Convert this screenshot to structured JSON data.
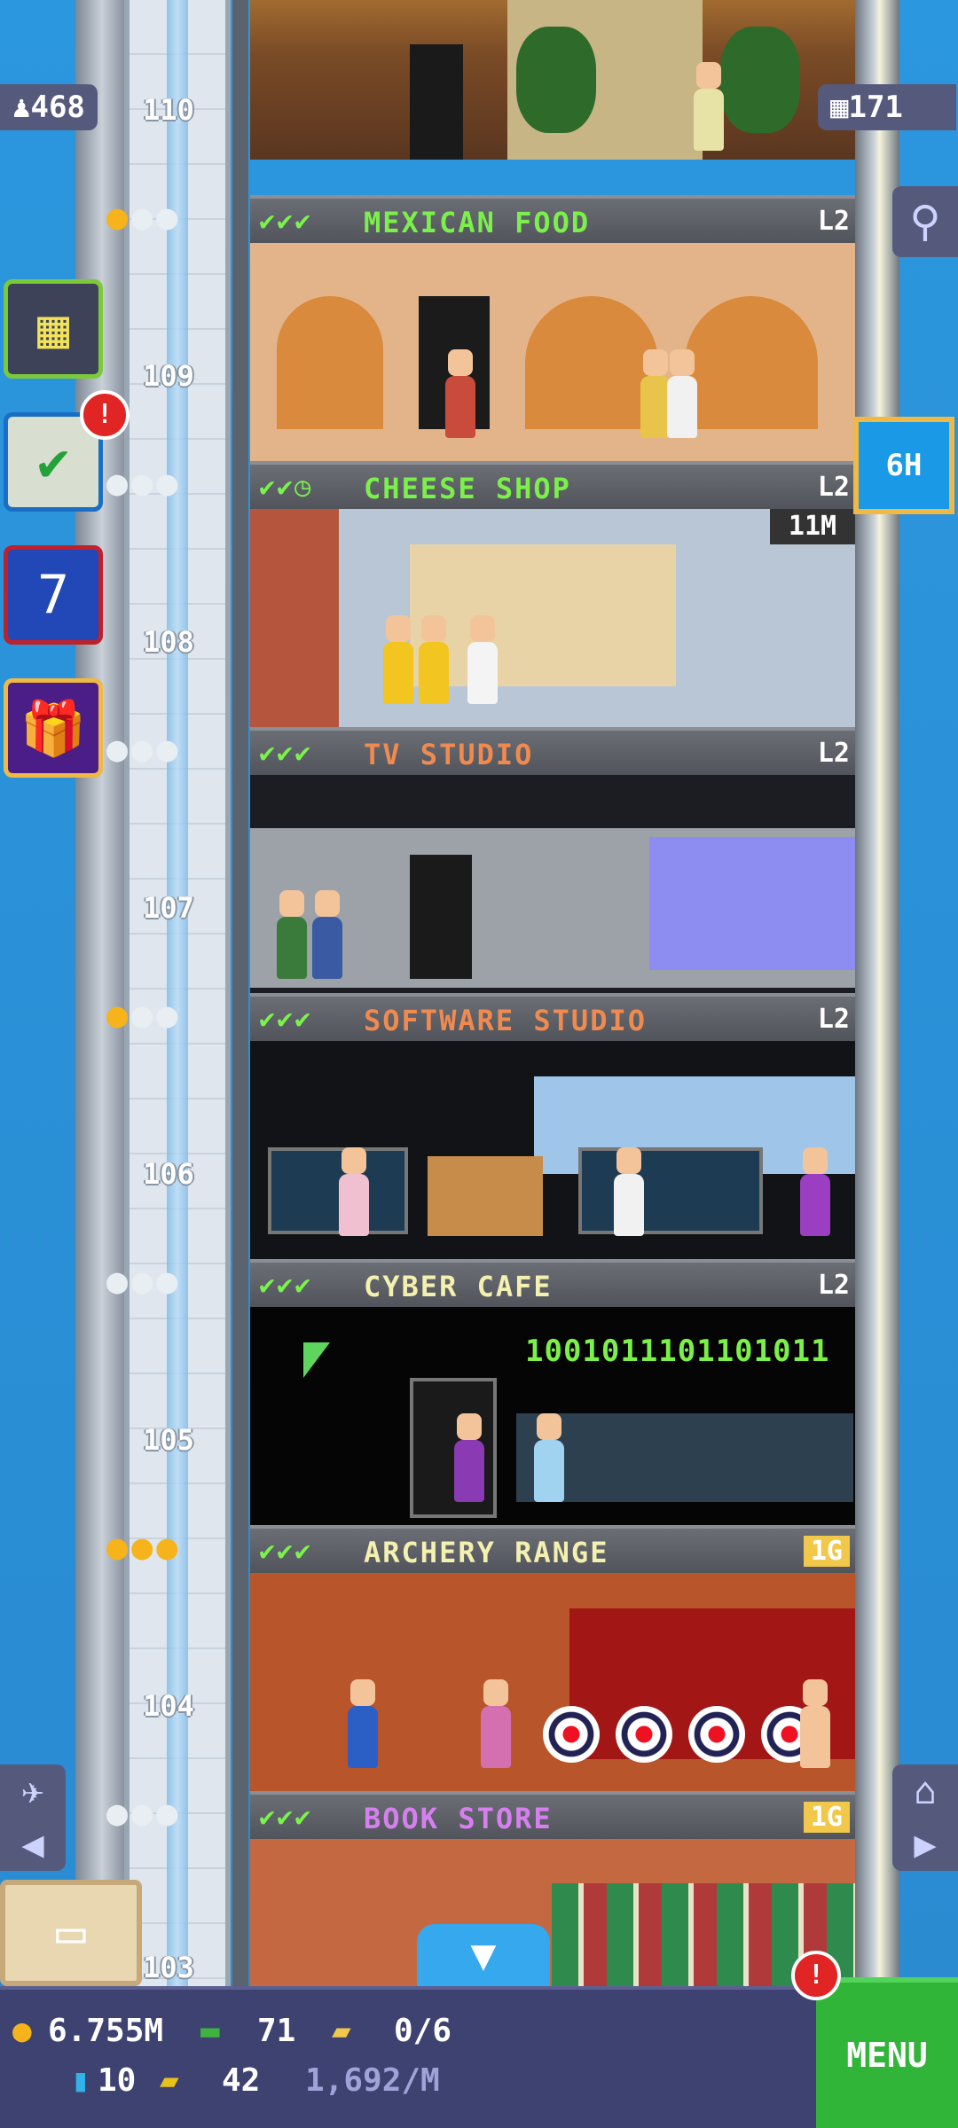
{
  "top": {
    "population": "468",
    "bitizen_icon": "person-icon",
    "floors_count": "171",
    "floors_icon": "building-icon"
  },
  "timer_button": {
    "label": "6H"
  },
  "left_buttons": [
    {
      "name": "build-floor-button",
      "icon": "building-grid-icon"
    },
    {
      "name": "missions-button",
      "icon": "checklist-icon",
      "alert": "!"
    },
    {
      "name": "calendar-button",
      "icon": "calendar-icon",
      "text": "7"
    },
    {
      "name": "gift-button",
      "icon": "gift-icon"
    }
  ],
  "floors": [
    {
      "number": "110",
      "name": "",
      "scene": "mexican-food-restaurant"
    },
    {
      "number": "109",
      "name": "MEXICAN FOOD",
      "checks": "✔✔✔",
      "level": "L2",
      "stars": 1,
      "name_color": "#7cf04a"
    },
    {
      "number": "108",
      "name": "CHEESE SHOP",
      "checks": "✔✔◷",
      "level": "L2",
      "stars": 0,
      "name_color": "#7cf04a",
      "timer": "11M"
    },
    {
      "number": "107",
      "name": "TV STUDIO",
      "checks": "✔✔✔",
      "level": "L2",
      "stars": 0,
      "name_color": "#f08a4f"
    },
    {
      "number": "106",
      "name": "SOFTWARE STUDIO",
      "checks": "✔✔✔",
      "level": "L2",
      "stars": 1,
      "name_color": "#f08a4f"
    },
    {
      "number": "105",
      "name": "CYBER CAFE",
      "checks": "✔✔✔",
      "level": "L2",
      "stars": 0,
      "name_color": "#f3f0b0",
      "code_text": "1001011101101011"
    },
    {
      "number": "104",
      "name": "ARCHERY RANGE",
      "checks": "✔✔✔",
      "level": "1G",
      "stars": 3,
      "name_color": "#f3f0b0"
    },
    {
      "number": "103",
      "name": "BOOK STORE",
      "checks": "✔✔✔",
      "level": "1G",
      "stars": 0,
      "name_color": "#d680f0"
    }
  ],
  "hud": {
    "coins": "6.755M",
    "bux": "71",
    "tickets": "0/6",
    "blue_items": "10",
    "golden_tickets": "42",
    "income": "1,692/M",
    "menu_label": "MENU",
    "menu_alert": "!"
  },
  "colors": {
    "sky": "#2a8fd8",
    "hud_bg": "#3e4270",
    "menu_green": "#31b539",
    "star_gold": "#f6b31c"
  }
}
